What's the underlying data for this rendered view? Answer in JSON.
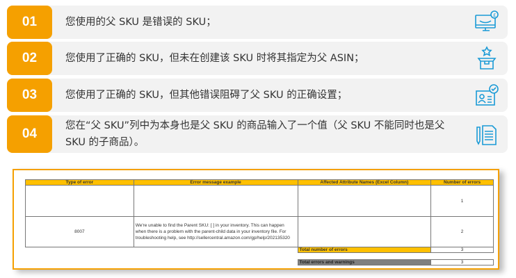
{
  "steps": [
    {
      "num": "01",
      "text": "您使用的父 SKU 是错误的 SKU；",
      "icon": "monitor-pound-icon"
    },
    {
      "num": "02",
      "text": "您使用了正确的 SKU，但未在创建该 SKU 时将其指定为父 ASIN；",
      "icon": "box-star-icon"
    },
    {
      "num": "03",
      "text": "您使用了正确的 SKU，但其他错误阻碍了父 SKU 的正确设置；",
      "icon": "id-card-check-icon"
    },
    {
      "num": "04",
      "text": "您在“父 SKU”列中为本身也是父 SKU 的商品输入了一个值（父 SKU 不能同时也是父 SKU 的子商品）。",
      "icon": "documents-pen-icon"
    }
  ],
  "table": {
    "headers": [
      "Type of error",
      "Error message example",
      "Affected Attribute Names (Excel Column)",
      "Number of errors"
    ],
    "rows": [
      {
        "type": "",
        "message": "",
        "attr": "",
        "count": "1"
      },
      {
        "type": "8007",
        "message": "We're unable to find the Parent SKU: [                    ] in your inventory. This can happen when there is a problem with the parent-child data in your inventory file. For troubleshooting help, see http://sellercentral.amazon.com/gp/help/202135320",
        "attr": "",
        "count": "2"
      }
    ],
    "total_label": "Total number of errors",
    "total_value": "3",
    "total_warn_label": "Total errors and warnings",
    "total_warn_value": "3"
  },
  "colors": {
    "accent": "#f5a000",
    "icon": "#1a9ad6",
    "header": "#ffc000"
  }
}
